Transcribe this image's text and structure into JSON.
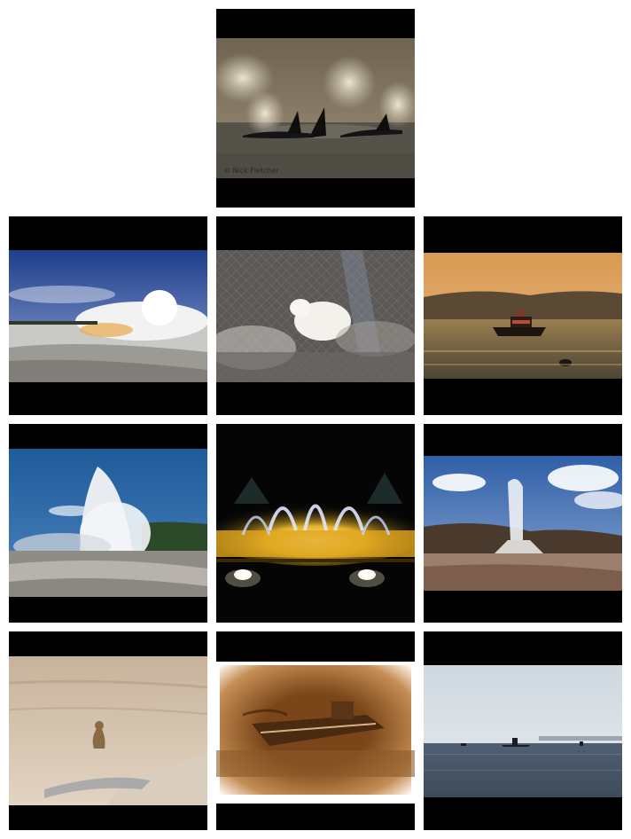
{
  "images": [
    {
      "subject": "orcas-geysers",
      "watermark": "© Nick Fletcher"
    },
    {
      "subject": "geyser-steam-field"
    },
    {
      "subject": "white-fox-behind-fence"
    },
    {
      "subject": "boat-sunset-harbor"
    },
    {
      "subject": "geyser-eruption"
    },
    {
      "subject": "illuminated-fountain-night"
    },
    {
      "subject": "geyser-cone-clouds"
    },
    {
      "subject": "coyote-sitting-desert"
    },
    {
      "subject": "sepia-shipwreck-photo"
    },
    {
      "subject": "submarine-on-water"
    }
  ]
}
